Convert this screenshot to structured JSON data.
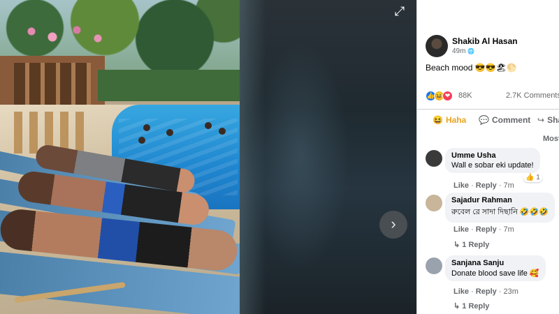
{
  "viewer": {
    "expand_icon": "expand-icon",
    "next_icon": "chevron-right-icon",
    "next_glyph": "›",
    "expand_glyph": "⤢"
  },
  "post": {
    "author": "Shakib Al Hasan",
    "time": "49m",
    "audience_icon": "globe-icon",
    "audience_glyph": "🌐",
    "text": "Beach mood 😎😎🏖🌕",
    "reactions": {
      "icons": [
        "like-icon",
        "haha-icon",
        "love-icon"
      ],
      "count": "88K",
      "comments": "2.7K Comments"
    },
    "actions": {
      "haha_label": "Haha",
      "comment_label": "Comment",
      "share_label": "Share"
    },
    "sort_label": "Most relevant"
  },
  "comments": [
    {
      "name": "Umme Usha",
      "text": "Wall e sobar eki update!",
      "like": "Like",
      "reply": "Reply",
      "time": "7m",
      "reaction_count": "1"
    },
    {
      "name": "Sajadur Rahman",
      "text": "রুবেল রে সাদা দিছানি 🤣🤣🤣",
      "like": "Like",
      "reply": "Reply",
      "time": "7m",
      "replies": "1 Reply"
    },
    {
      "name": "Sanjana Sanju",
      "text": "Donate blood save life 🥰",
      "like": "Like",
      "reply": "Reply",
      "time": "23m",
      "replies": "1 Reply"
    }
  ],
  "colors": {
    "facebook_blue": "#1877f2",
    "haha_yellow": "#e7a521",
    "love_red": "#f33e58",
    "muted_text": "#65676b"
  }
}
